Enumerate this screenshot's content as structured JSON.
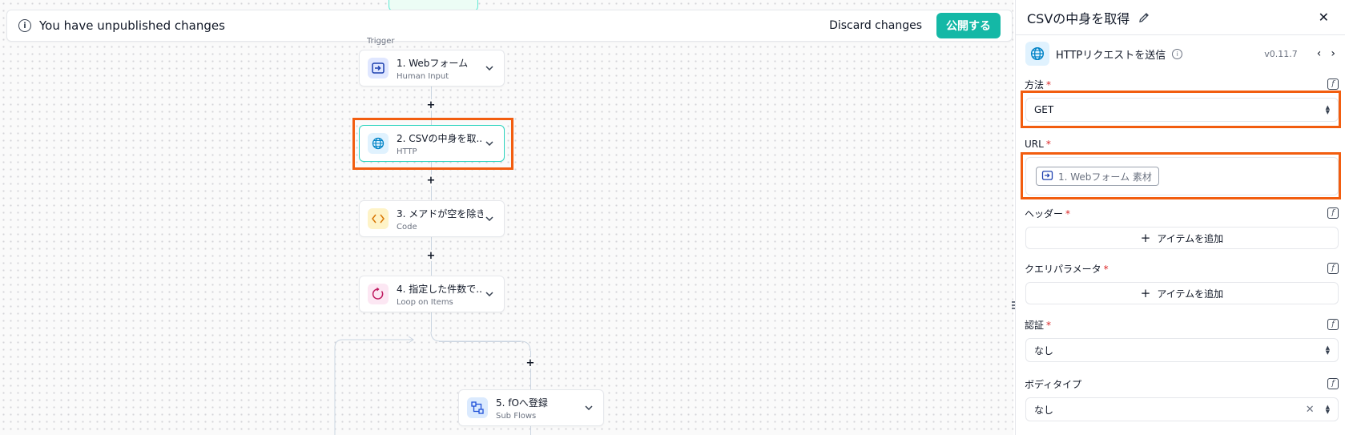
{
  "banner": {
    "message": "You have unpublished changes",
    "discard_label": "Discard changes",
    "publish_label": "公開する"
  },
  "canvas": {
    "trigger_label": "Trigger",
    "nodes": [
      {
        "title": "1. Webフォーム",
        "subtitle": "Human Input",
        "icon": "form-input-icon"
      },
      {
        "title": "2. CSVの中身を取...",
        "subtitle": "HTTP",
        "icon": "globe-icon"
      },
      {
        "title": "3. メアドが空を除き...",
        "subtitle": "Code",
        "icon": "code-icon"
      },
      {
        "title": "4. 指定した件数で...",
        "subtitle": "Loop on Items",
        "icon": "loop-icon"
      },
      {
        "title": "5. fOへ登録",
        "subtitle": "Sub Flows",
        "icon": "subflow-icon"
      }
    ],
    "add_step_symbol": "+"
  },
  "panel": {
    "title": "CSVの中身を取得",
    "action_label": "HTTPリクエストを送信",
    "version": "v0.11.7",
    "fields": {
      "method": {
        "label": "方法",
        "value": "GET"
      },
      "url": {
        "label": "URL",
        "chip": "1. Webフォーム 素材"
      },
      "headers": {
        "label": "ヘッダー",
        "add_label": "アイテムを追加"
      },
      "query": {
        "label": "クエリパラメータ",
        "add_label": "アイテムを追加"
      },
      "auth": {
        "label": "認証",
        "value": "なし"
      },
      "body_type": {
        "label": "ボディタイプ",
        "value": "なし"
      }
    },
    "required_mark": "*"
  },
  "colors": {
    "accent": "#14b8a6",
    "highlight": "#f25d0f",
    "selected_node_border": "#2dd4bf"
  }
}
